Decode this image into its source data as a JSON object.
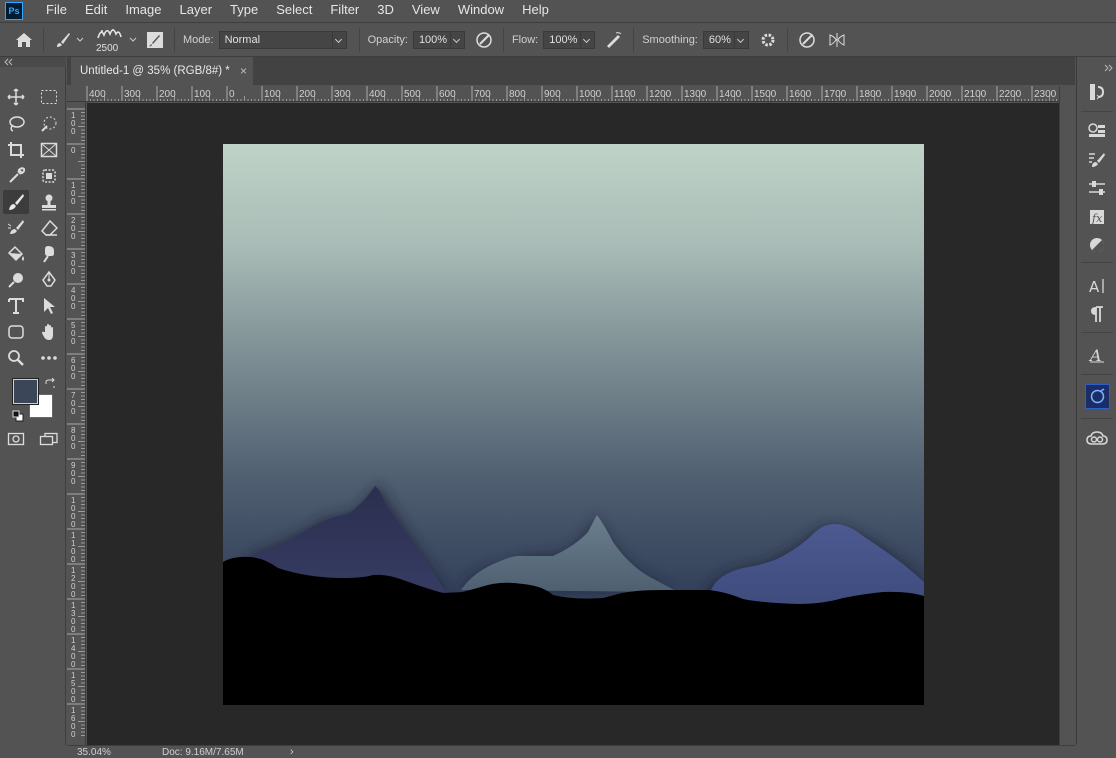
{
  "app": {
    "logo_text": "Ps"
  },
  "menu": [
    "File",
    "Edit",
    "Image",
    "Layer",
    "Type",
    "Select",
    "Filter",
    "3D",
    "View",
    "Window",
    "Help"
  ],
  "options": {
    "brush_size": "2500",
    "mode_label": "Mode:",
    "mode_value": "Normal",
    "opacity_label": "Opacity:",
    "opacity_value": "100%",
    "flow_label": "Flow:",
    "flow_value": "100%",
    "smoothing_label": "Smoothing:",
    "smoothing_value": "60%"
  },
  "document": {
    "tab_title": "Untitled-1 @ 35% (RGB/8#) *",
    "close_glyph": "×"
  },
  "rulers": {
    "horizontal": [
      "400",
      "300",
      "200",
      "100",
      "0",
      "100",
      "200",
      "300",
      "400",
      "500",
      "600",
      "700",
      "800",
      "900",
      "1000",
      "1100",
      "1200",
      "1300",
      "1400",
      "1500",
      "1600",
      "1700",
      "1800",
      "1900",
      "2000",
      "2100",
      "2200",
      "2300"
    ],
    "vertical": [
      "1\n0\n0",
      "0",
      "1\n0\n0",
      "2\n0\n0",
      "3\n0\n0",
      "4\n0\n0",
      "5\n0\n0",
      "6\n0\n0",
      "7\n0\n0",
      "8\n0\n0",
      "9\n0\n0",
      "1\n0\n0\n0",
      "1\n1\n0\n0",
      "1\n2\n0\n0",
      "1\n3\n0\n0",
      "1\n4\n0\n0",
      "1\n5\n0\n0",
      "1\n6\n0\n0"
    ]
  },
  "colors": {
    "foreground": "#3b4658",
    "background": "#ffffff",
    "sky_top": "#c0d3c8",
    "sky_bottom": "#2f3c52"
  },
  "status": {
    "zoom": "35.04%",
    "doc_info": "Doc: 9.16M/7.65M",
    "arrow": "›"
  },
  "tools": [
    "move-tool",
    "marquee-tool",
    "lasso-tool",
    "quick-select-tool",
    "crop-tool",
    "frame-tool",
    "eyedropper-tool",
    "patch-tool",
    "brush-tool",
    "stamp-tool",
    "history-brush-tool",
    "eraser-tool",
    "paint-bucket-tool",
    "smudge-tool",
    "dodge-tool",
    "pen-tool",
    "type-tool",
    "path-select-tool",
    "shape-tool",
    "hand-tool",
    "zoom-tool",
    "more-tools"
  ]
}
